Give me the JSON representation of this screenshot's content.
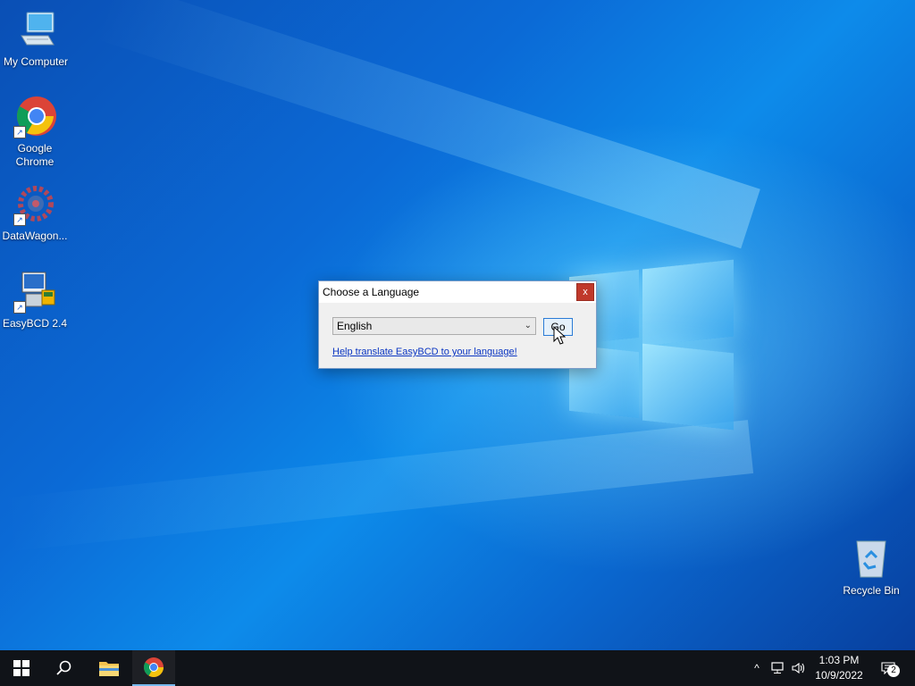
{
  "desktop": {
    "icons": [
      {
        "label": "My Computer"
      },
      {
        "label": "Google\nChrome"
      },
      {
        "label": "DataWagon..."
      },
      {
        "label": "EasyBCD 2.4"
      },
      {
        "label": "Recycle Bin"
      }
    ]
  },
  "dialog": {
    "title": "Choose a Language",
    "close_label": "x",
    "language_selected": "English",
    "go_label": "Go",
    "help_link": "Help translate EasyBCD to your language!"
  },
  "taskbar": {
    "time": "1:03 PM",
    "date": "10/9/2022",
    "notification_count": "2"
  },
  "colors": {
    "taskbar_bg": "#101318",
    "link": "#0b36c2",
    "close_btn": "#c0392b"
  }
}
